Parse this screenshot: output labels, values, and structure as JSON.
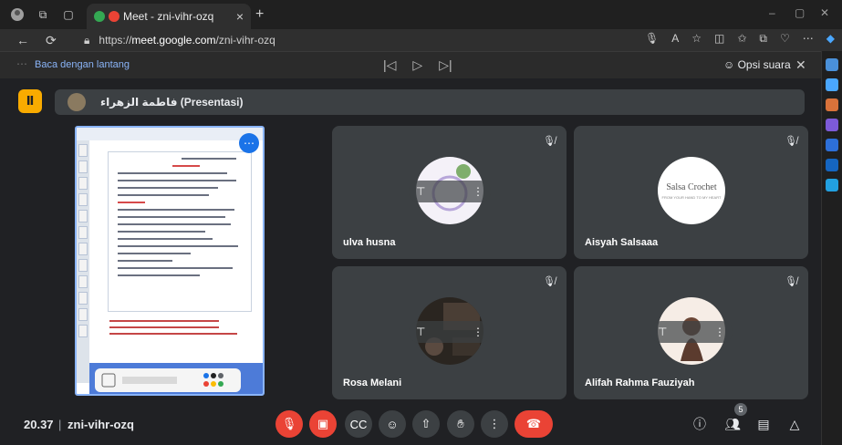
{
  "browser": {
    "tab_title": "Meet - zni-vihr-ozq",
    "new_tab": "+",
    "tab_close": "×",
    "url_scheme": "https://",
    "url_host": "meet.google.com",
    "url_path": "/zni-vihr-ozq",
    "minimize": "–",
    "restore": "▢",
    "close": "✕"
  },
  "reader": {
    "label": "Baca dengan lantang",
    "voice_options": "Opsi suara",
    "close": "✕"
  },
  "presentation": {
    "badge": "Ⅱ",
    "presenter_label": "فاطمة الزهراء (Presentasi)"
  },
  "participants": [
    {
      "name": "ulva husna",
      "avatar": "floral-avatar"
    },
    {
      "name": "Aisyah Salsaaa",
      "avatar": "logo-avatar",
      "logo_text": "Salsa Crochet",
      "logo_sub": "FROM YOUR HAND TO MY HEART"
    },
    {
      "name": "Rosa Melani",
      "avatar": "poster-avatar"
    },
    {
      "name": "Alifah Rahma Fauziyah",
      "avatar": "portrait-avatar"
    }
  ],
  "meeting": {
    "time": "20.37",
    "separator": "|",
    "code": "zni-vihr-ozq",
    "people_count": "5"
  },
  "colors": {
    "accent": "#8ab4f8",
    "danger": "#ea4335",
    "tile": "#3c4043",
    "badge": "#f9ab00"
  }
}
